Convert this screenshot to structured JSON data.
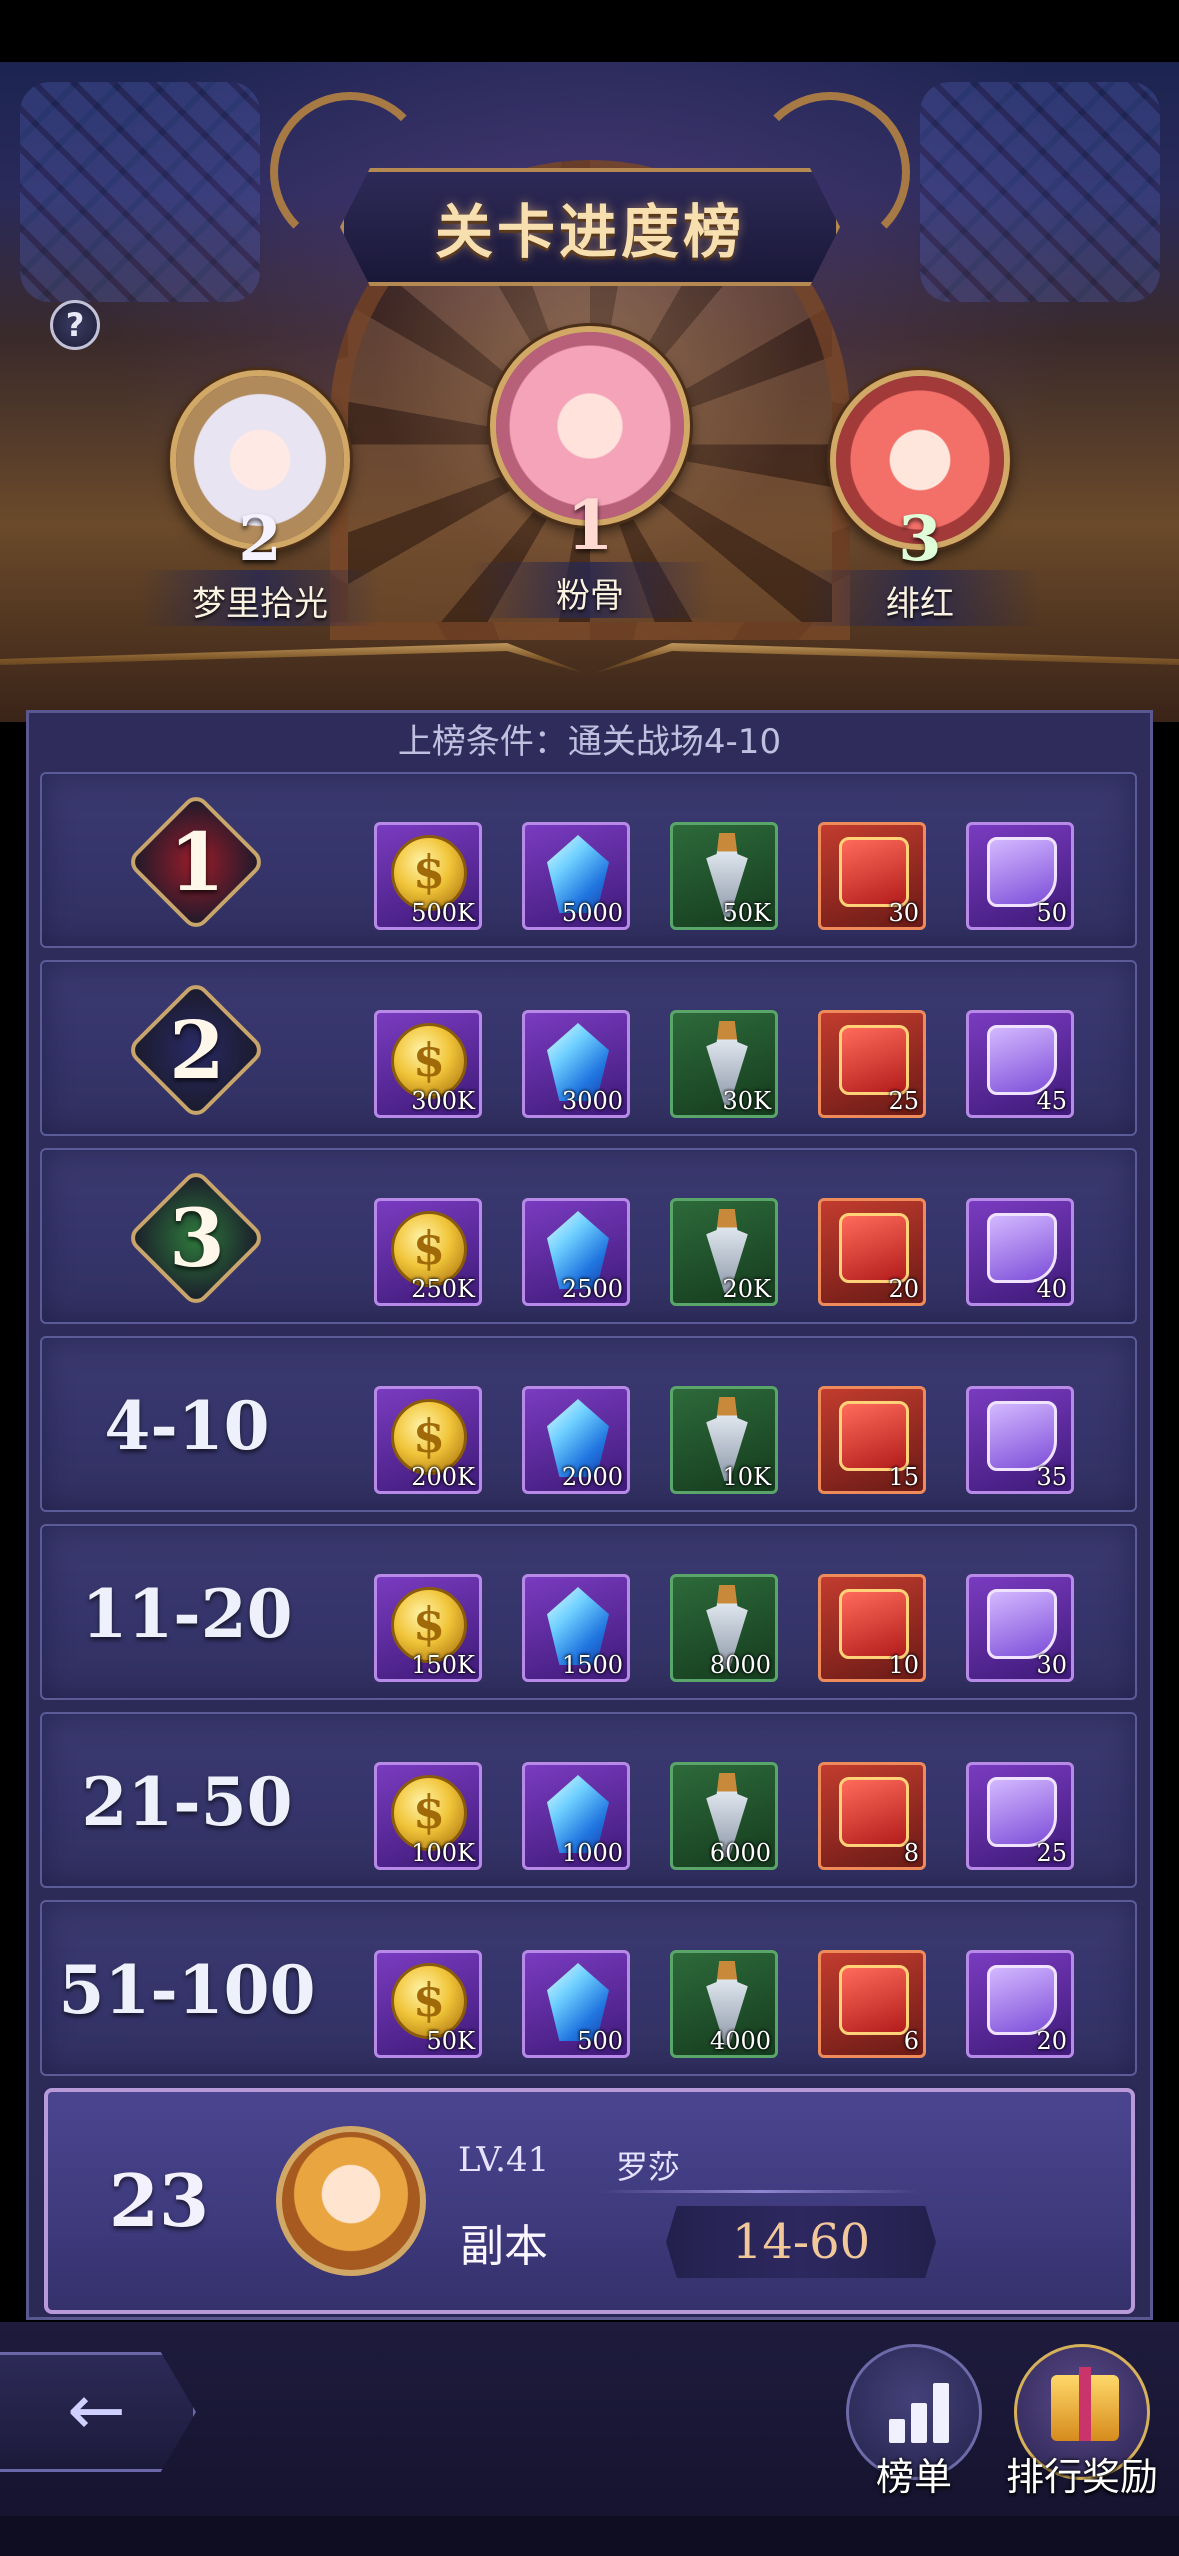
{
  "header": {
    "title": "关卡进度榜",
    "help_label": "?"
  },
  "podium": [
    {
      "rank": "2",
      "name": "梦里拾光"
    },
    {
      "rank": "1",
      "name": "粉骨"
    },
    {
      "rank": "3",
      "name": "绯红"
    }
  ],
  "condition": "上榜条件：通关战场4-10",
  "rewards": [
    {
      "rank": "1",
      "medal": true,
      "items": [
        "500K",
        "5000",
        "50K",
        "30",
        "50"
      ]
    },
    {
      "rank": "2",
      "medal": true,
      "items": [
        "300K",
        "3000",
        "30K",
        "25",
        "45"
      ]
    },
    {
      "rank": "3",
      "medal": true,
      "items": [
        "250K",
        "2500",
        "20K",
        "20",
        "40"
      ]
    },
    {
      "rank": "4-10",
      "medal": false,
      "items": [
        "200K",
        "2000",
        "10K",
        "15",
        "35"
      ]
    },
    {
      "rank": "11-20",
      "medal": false,
      "items": [
        "150K",
        "1500",
        "8000",
        "10",
        "30"
      ]
    },
    {
      "rank": "21-50",
      "medal": false,
      "items": [
        "100K",
        "1000",
        "6000",
        "8",
        "25"
      ]
    },
    {
      "rank": "51-100",
      "medal": false,
      "items": [
        "50K",
        "500",
        "4000",
        "6",
        "20"
      ]
    }
  ],
  "item_types": [
    "gold-coin-icon",
    "blue-crystal-icon",
    "dagger-icon",
    "red-scroll-icon",
    "purple-scroll-icon"
  ],
  "colors": {
    "medal_1": "#9b1c2a",
    "medal_2": "#2a2a66",
    "medal_3": "#2e7a3c",
    "accent_gold": "#d2a866"
  },
  "my_rank": {
    "rank": "23",
    "level": "LV.41",
    "name": "罗莎",
    "stage_label": "副本",
    "stage_value": "14-60"
  },
  "footer": {
    "back_icon": "back-arrow-icon",
    "board_label": "榜单",
    "reward_label": "排行奖励"
  }
}
